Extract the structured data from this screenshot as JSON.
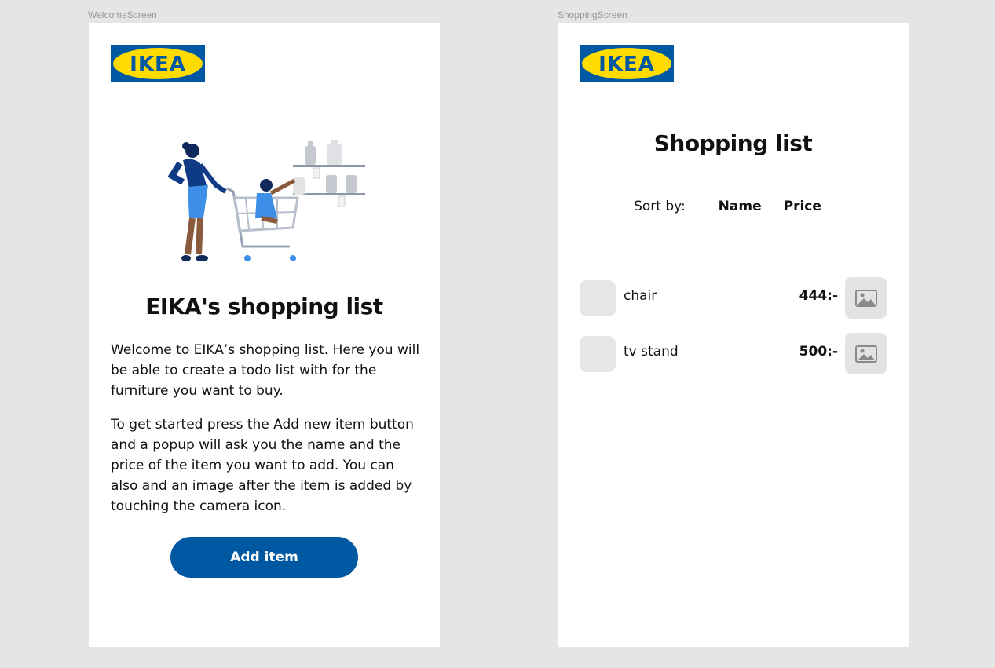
{
  "colors": {
    "canvas": "#e5e5e5",
    "screen": "#ffffff",
    "ikea_blue": "#0058a3",
    "ikea_yellow": "#ffdb00",
    "placeholder": "#e6e6e6"
  },
  "frames": {
    "welcome_label": "WelcomeScreen",
    "shopping_label": "ShoppingScreen"
  },
  "logo": {
    "text": "IKEA"
  },
  "welcome": {
    "title": "EIKA's shopping list",
    "paragraph1": "Welcome to EIKA’s shopping list. Here you will be able to create a todo list with for the furniture you want to buy.",
    "paragraph2": "To get started press the Add new item button and a popup will ask you the name and the price of the item you want to add. You can also and an image after the item is added by touching the camera icon.",
    "add_button": "Add item",
    "illustration_icon": "shopper-with-cart-illustration"
  },
  "shopping": {
    "title": "Shopping list",
    "sort_label": "Sort by:",
    "sort_options": [
      "Name",
      "Price"
    ],
    "items": [
      {
        "name": "chair",
        "price": "444:-",
        "icon": "image-placeholder-icon"
      },
      {
        "name": "tv stand",
        "price": "500:-",
        "icon": "image-placeholder-icon"
      }
    ]
  }
}
